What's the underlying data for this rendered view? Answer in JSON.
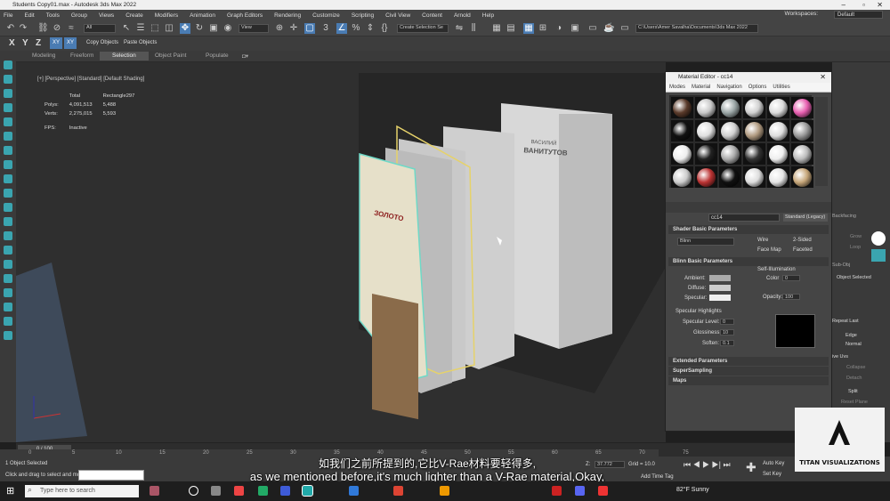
{
  "window": {
    "title": "Students Copy01.max - Autodesk 3ds Max 2022"
  },
  "menus": [
    "File",
    "Edit",
    "Tools",
    "Group",
    "Views",
    "Create",
    "Modifiers",
    "Animation",
    "Graph Editors",
    "Rendering",
    "Customize",
    "Scripting",
    "Civil View",
    "Content",
    "Arnold",
    "Help"
  ],
  "workspace": {
    "label": "Workspaces:",
    "value": "Default"
  },
  "toolbar": {
    "filter": "All",
    "view": "View",
    "selection_set": "Create Selection Se",
    "path": "C:\\Users\\Amer Savalha\\Documents\\3ds Max 2022"
  },
  "toolbar2": {
    "axes": [
      "X",
      "Y",
      "Z",
      "XY",
      "XY"
    ],
    "copy": "Copy Objects",
    "paste": "Paste Objects"
  },
  "ribbon": {
    "tabs": [
      "Modeling",
      "Freeform",
      "Selection",
      "Object Paint",
      "Populate"
    ],
    "active": "Selection"
  },
  "viewport": {
    "label": "[+] [Perspective] [Standard] [Default Shading]",
    "stats": {
      "headers": [
        "",
        "Total",
        "Rectangle297"
      ],
      "rows": [
        [
          "Polys:",
          "4,091,513",
          "5,488"
        ],
        [
          "Verts:",
          "2,275,015",
          "5,593"
        ]
      ],
      "fps_label": "FPS:",
      "fps_value": "Inactive"
    }
  },
  "book": {
    "title": "ВАСИЛИЙ",
    "subtitle": "ВАНИТУТОВ",
    "cover_title": "ЗОЛОТО"
  },
  "material_editor": {
    "title": "Material Editor - cc14",
    "menus": [
      "Modes",
      "Material",
      "Navigation",
      "Options",
      "Utilities"
    ],
    "sphere_colors": [
      "#5a3a2a",
      "#c8c8c8",
      "#9aa5a5",
      "#d0d0d0",
      "#dcdcdc",
      "#e85fb0",
      "#111111",
      "#e0e0e0",
      "#cfcfcf",
      "#b09a80",
      "#ddd",
      "#999",
      "#eee",
      "#222",
      "#aaa",
      "#333",
      "#eee",
      "#bbb",
      "#ccc",
      "#b33",
      "#101010",
      "#ddd",
      "#e6e6e6",
      "#c7a77a"
    ],
    "material_name": "cc14",
    "material_type": "Standard (Legacy)",
    "shader_header": "Shader Basic Parameters",
    "shader": "Blinn",
    "wire": "Wire",
    "two_sided": "2-Sided",
    "face_map": "Face Map",
    "faceted": "Faceted",
    "blinn_header": "Blinn Basic Parameters",
    "self_illum": "Self-Illumination",
    "color_label": "Color",
    "color_value": "0",
    "ambient": "Ambient:",
    "diffuse": "Diffuse:",
    "specular": "Specular:",
    "opacity_label": "Opacity:",
    "opacity_value": "100",
    "spec_header": "Specular Highlights",
    "spec_level_label": "Specular Level:",
    "spec_level": "0",
    "gloss_label": "Glossiness:",
    "gloss": "10",
    "soften_label": "Soften:",
    "soften": "0.1",
    "rollouts": [
      "Extended Parameters",
      "SuperSampling",
      "Maps"
    ]
  },
  "right_panel": {
    "items": [
      "Backfacing",
      "Grow",
      "Loop",
      "Edge",
      "Normal",
      "Collapse",
      "Detach",
      "Split",
      "Reset Plane",
      "Object Selected",
      "Repeat Last",
      "Sub-Obj",
      "ive Uvs"
    ]
  },
  "timeline": {
    "frame": "0 / 100",
    "ticks": [
      "0",
      "5",
      "10",
      "15",
      "20",
      "25",
      "30",
      "35",
      "40",
      "45",
      "50",
      "55",
      "60",
      "65",
      "70",
      "75"
    ]
  },
  "status": {
    "selected": "1 Object Selected",
    "hint": "Click and drag to select and move",
    "z_label": "Z:",
    "z_value": "37.772",
    "grid": "Grid = 10.0",
    "autokey": "Auto Key",
    "setkey": "Set Key",
    "selected_filter": "Selected",
    "add_tag": "Add Time Tag"
  },
  "subtitles": {
    "chinese": "如我们之前所提到的,它比V-Rae材料要轻得多,",
    "english": "as we mentioned before,it's much lighter than a V-Rae material,Okay,"
  },
  "taskbar": {
    "search": "Type here to search",
    "weather": "82°F  Sunny"
  },
  "logo": {
    "text": "TITAN VISUALIZATIONS"
  }
}
